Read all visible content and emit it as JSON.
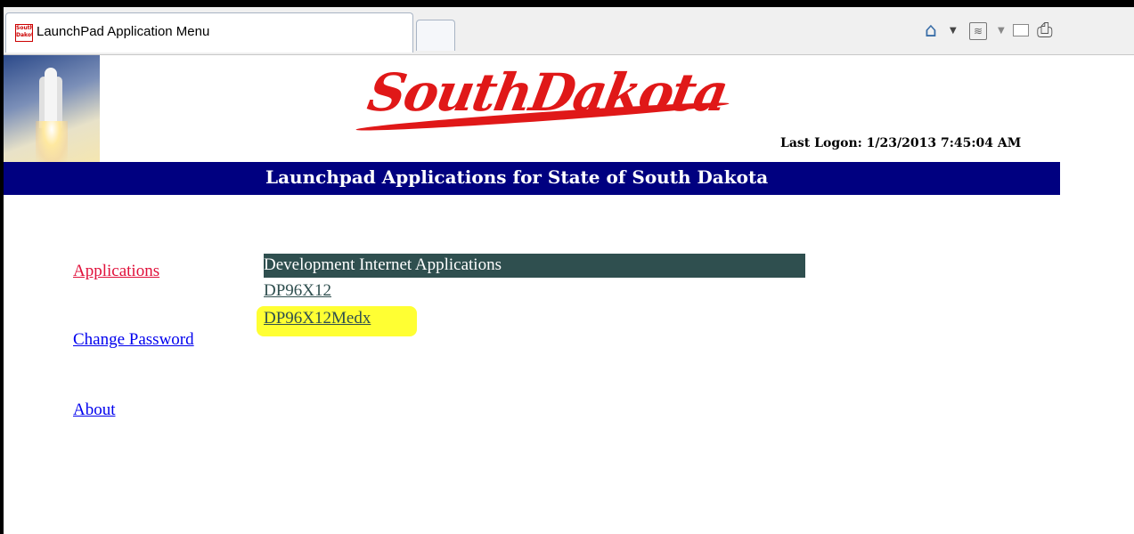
{
  "browser": {
    "tab_title": "LaunchPad Application Menu",
    "favicon_text": "South Dakota",
    "toolbar_icons": [
      "home-icon",
      "feeds-icon",
      "mail-icon",
      "print-icon"
    ]
  },
  "header": {
    "logo_text": "SouthDakota",
    "last_logon": "Last Logon: 1/23/2013 7:45:04 AM",
    "banner_title": "Launchpad Applications for State of South Dakota"
  },
  "nav": {
    "applications": "Applications",
    "change_password": "Change Password",
    "about": "About"
  },
  "applications": {
    "group_title": "Development Internet Applications",
    "items": [
      "DP96X12",
      "DP96X12Medx"
    ]
  },
  "colors": {
    "banner_bg": "#000080",
    "group_header_bg": "#2f4f4f",
    "active_nav": "#e0103a",
    "link": "#0000ee",
    "highlight": "#ffff33",
    "logo": "#e01818"
  }
}
